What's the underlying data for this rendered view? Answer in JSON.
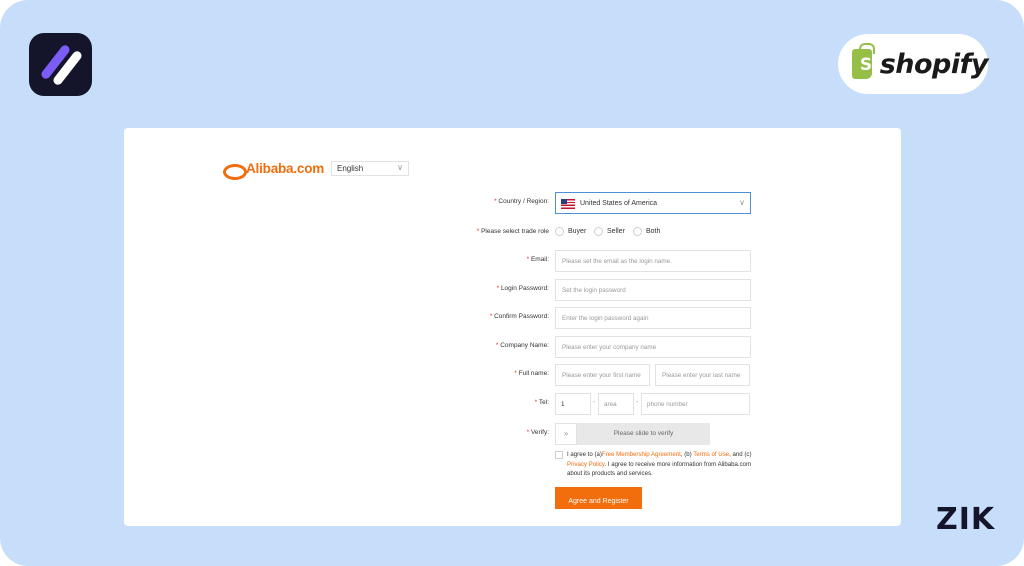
{
  "brand_badge": {
    "text": "shopify",
    "bag_letter": "S"
  },
  "corner_mark": "ZIK",
  "alibaba": {
    "logo_text": "Alibaba.com",
    "language": "English"
  },
  "form": {
    "country": {
      "label": "Country / Region:",
      "value": "United States of America"
    },
    "trade_role": {
      "label": "Please select trade role",
      "options": [
        "Buyer",
        "Seller",
        "Both"
      ]
    },
    "email": {
      "label": "Email:",
      "placeholder": "Please set the email as the login name."
    },
    "login_password": {
      "label": "Login Password:",
      "placeholder": "Set the login password"
    },
    "confirm_password": {
      "label": "Confirm Password:",
      "placeholder": "Enter the login password again"
    },
    "company_name": {
      "label": "Company Name:",
      "placeholder": "Please enter your company name"
    },
    "full_name": {
      "label": "Full name:",
      "first_placeholder": "Please enter your first name",
      "last_placeholder": "Please enter your last name"
    },
    "tel": {
      "label": "Tel:",
      "country_code": "1",
      "area_placeholder": "area",
      "phone_placeholder": "phone number",
      "separator": "-"
    },
    "verify": {
      "label": "Verify:",
      "handle": "»",
      "text": "Please slide to verify"
    },
    "required_mark": "*",
    "agreement": {
      "part1": "I agree to (a)",
      "link1": "Free Membership Agreement",
      "part2": ", (b) ",
      "link2": "Terms of Use",
      "part3": ", and (c) ",
      "link3": "Privacy Policy",
      "part4": ". I agree to receive more information from Alibaba.com about its products and services."
    },
    "submit_label": "Agree and Register"
  }
}
